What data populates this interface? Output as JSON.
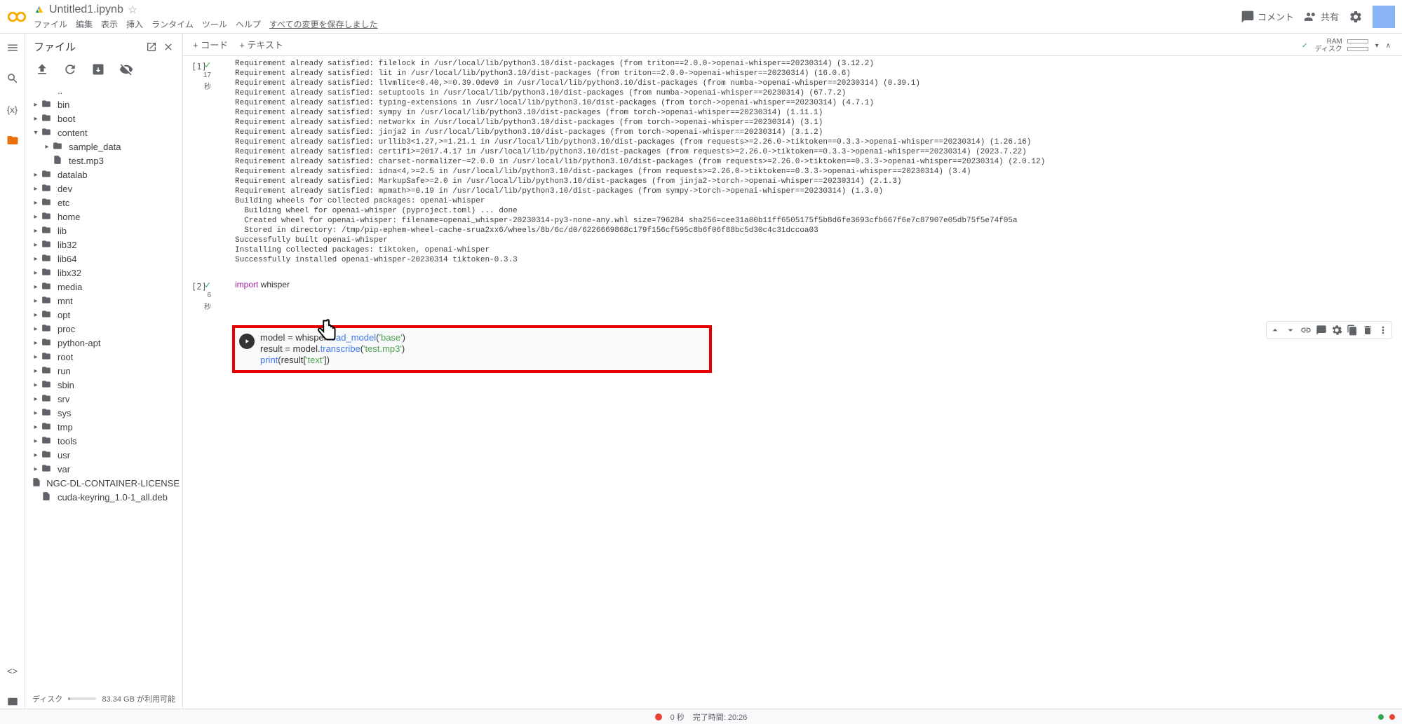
{
  "header": {
    "title": "Untitled1.ipynb",
    "menu": [
      "ファイル",
      "編集",
      "表示",
      "挿入",
      "ランタイム",
      "ツール",
      "ヘルプ"
    ],
    "save_msg": "すべての変更を保存しました",
    "comment": "コメント",
    "share": "共有"
  },
  "sidebar": {
    "title": "ファイル",
    "disk_label": "ディスク",
    "disk_free": "83.34 GB が利用可能",
    "tree": [
      {
        "name": "..",
        "type": "up"
      },
      {
        "name": "bin",
        "type": "folder"
      },
      {
        "name": "boot",
        "type": "folder"
      },
      {
        "name": "content",
        "type": "folder",
        "expanded": true,
        "children": [
          {
            "name": "sample_data",
            "type": "folder"
          },
          {
            "name": "test.mp3",
            "type": "file"
          }
        ]
      },
      {
        "name": "datalab",
        "type": "folder"
      },
      {
        "name": "dev",
        "type": "folder"
      },
      {
        "name": "etc",
        "type": "folder"
      },
      {
        "name": "home",
        "type": "folder"
      },
      {
        "name": "lib",
        "type": "folder"
      },
      {
        "name": "lib32",
        "type": "folder"
      },
      {
        "name": "lib64",
        "type": "folder"
      },
      {
        "name": "libx32",
        "type": "folder"
      },
      {
        "name": "media",
        "type": "folder"
      },
      {
        "name": "mnt",
        "type": "folder"
      },
      {
        "name": "opt",
        "type": "folder"
      },
      {
        "name": "proc",
        "type": "folder"
      },
      {
        "name": "python-apt",
        "type": "folder"
      },
      {
        "name": "root",
        "type": "folder"
      },
      {
        "name": "run",
        "type": "folder"
      },
      {
        "name": "sbin",
        "type": "folder"
      },
      {
        "name": "srv",
        "type": "folder"
      },
      {
        "name": "sys",
        "type": "folder"
      },
      {
        "name": "tmp",
        "type": "folder"
      },
      {
        "name": "tools",
        "type": "folder"
      },
      {
        "name": "usr",
        "type": "folder"
      },
      {
        "name": "var",
        "type": "folder"
      },
      {
        "name": "NGC-DL-CONTAINER-LICENSE",
        "type": "file"
      },
      {
        "name": "cuda-keyring_1.0-1_all.deb",
        "type": "file"
      }
    ]
  },
  "toolbar": {
    "code": "+ コード",
    "text": "+ テキスト"
  },
  "resources": {
    "ram": "RAM",
    "disk": "ディスク"
  },
  "cells": {
    "cell1_num": "[1]",
    "cell1_sec": "17",
    "cell1_sec2": "秒",
    "cell1_output": "Requirement already satisfied: filelock in /usr/local/lib/python3.10/dist-packages (from triton==2.0.0->openai-whisper==20230314) (3.12.2)\nRequirement already satisfied: lit in /usr/local/lib/python3.10/dist-packages (from triton==2.0.0->openai-whisper==20230314) (16.0.6)\nRequirement already satisfied: llvmlite<0.40,>=0.39.0dev0 in /usr/local/lib/python3.10/dist-packages (from numba->openai-whisper==20230314) (0.39.1)\nRequirement already satisfied: setuptools in /usr/local/lib/python3.10/dist-packages (from numba->openai-whisper==20230314) (67.7.2)\nRequirement already satisfied: typing-extensions in /usr/local/lib/python3.10/dist-packages (from torch->openai-whisper==20230314) (4.7.1)\nRequirement already satisfied: sympy in /usr/local/lib/python3.10/dist-packages (from torch->openai-whisper==20230314) (1.11.1)\nRequirement already satisfied: networkx in /usr/local/lib/python3.10/dist-packages (from torch->openai-whisper==20230314) (3.1)\nRequirement already satisfied: jinja2 in /usr/local/lib/python3.10/dist-packages (from torch->openai-whisper==20230314) (3.1.2)\nRequirement already satisfied: urllib3<1.27,>=1.21.1 in /usr/local/lib/python3.10/dist-packages (from requests>=2.26.0->tiktoken==0.3.3->openai-whisper==20230314) (1.26.16)\nRequirement already satisfied: certifi>=2017.4.17 in /usr/local/lib/python3.10/dist-packages (from requests>=2.26.0->tiktoken==0.3.3->openai-whisper==20230314) (2023.7.22)\nRequirement already satisfied: charset-normalizer~=2.0.0 in /usr/local/lib/python3.10/dist-packages (from requests>=2.26.0->tiktoken==0.3.3->openai-whisper==20230314) (2.0.12)\nRequirement already satisfied: idna<4,>=2.5 in /usr/local/lib/python3.10/dist-packages (from requests>=2.26.0->tiktoken==0.3.3->openai-whisper==20230314) (3.4)\nRequirement already satisfied: MarkupSafe>=2.0 in /usr/local/lib/python3.10/dist-packages (from jinja2->torch->openai-whisper==20230314) (2.1.3)\nRequirement already satisfied: mpmath>=0.19 in /usr/local/lib/python3.10/dist-packages (from sympy->torch->openai-whisper==20230314) (1.3.0)\nBuilding wheels for collected packages: openai-whisper\n  Building wheel for openai-whisper (pyproject.toml) ... done\n  Created wheel for openai-whisper: filename=openai_whisper-20230314-py3-none-any.whl size=796284 sha256=cee31a00b11ff6505175f5b8d6fe3693cfb667f6e7c87907e05db75f5e74f05a\n  Stored in directory: /tmp/pip-ephem-wheel-cache-srua2xx6/wheels/8b/6c/d0/6226669868c179f156cf595c8b6f06f88bc5d30c4c31dccoa03\nSuccessfully built openai-whisper\nInstalling collected packages: tiktoken, openai-whisper\nSuccessfully installed openai-whisper-20230314 tiktoken-0.3.3",
    "cell2_num": "[2]",
    "cell2_sec": "6",
    "cell2_sec2": "秒",
    "cell2_code_import": "import",
    "cell2_code_whisper": " whisper",
    "cell3_l1a": "model = whisper.",
    "cell3_l1b": "load_model",
    "cell3_l1c": "(",
    "cell3_l1d": "'base'",
    "cell3_l1e": ")",
    "cell3_l2a": "result = model.",
    "cell3_l2b": "transcribe",
    "cell3_l2c": "(",
    "cell3_l2d": "'test.mp3'",
    "cell3_l2e": ")",
    "cell3_l3a": "print",
    "cell3_l3b": "(result[",
    "cell3_l3c": "'text'",
    "cell3_l3d": "])"
  },
  "footer": {
    "sec": "0 秒",
    "done": "完了時間: 20:26"
  }
}
